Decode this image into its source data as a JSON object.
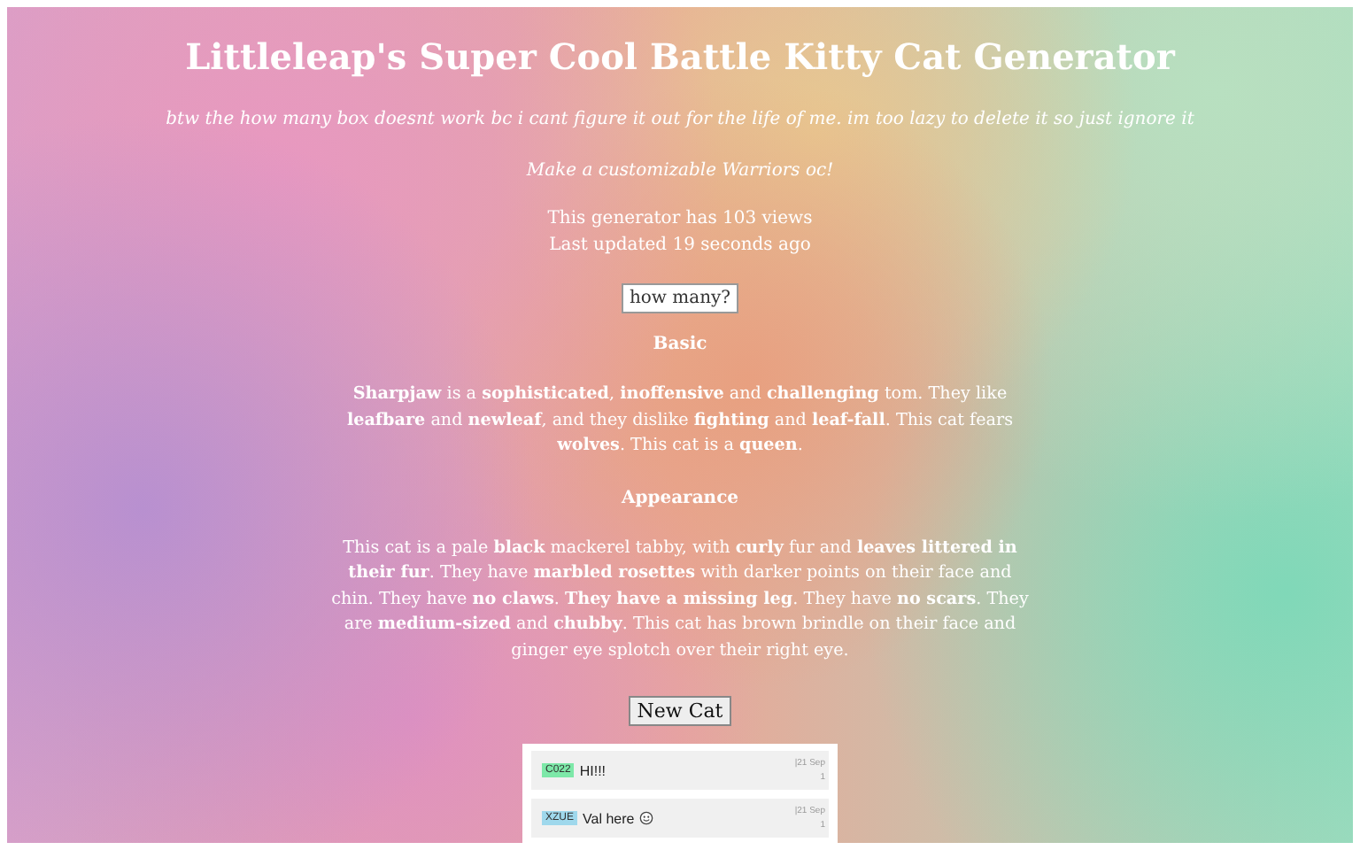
{
  "title": "Littleleap's Super Cool Battle Kitty Cat Generator",
  "note": "btw the how many box doesnt work bc i cant figure it out for the life of me. im too lazy to delete it so just ignore it",
  "tagline": "Make a customizable Warriors oc!",
  "views": "This generator has 103 views",
  "updated": "Last updated 19 seconds ago",
  "how_many_field": {
    "value": "how many?"
  },
  "sections": [
    {
      "heading": "Basic",
      "text": "**Sharpjaw** is a **sophisticated**, **inoffensive** and **challenging** tom. They like **leafbare** and **newleaf**, and they dislike **fighting** and **leaf-fall**. This cat fears **wolves**. This cat is a **queen**."
    },
    {
      "heading": "Appearance",
      "text": "This cat is a pale **black** mackerel tabby, with **curly** fur and **leaves littered in their fur**. They have **marbled rosettes** with darker points on their face and chin. They have **no claws**. **They have a missing leg**. They have **no scars**. They are **medium-sized** and **chubby**. This cat has brown brindle on their face and ginger eye splotch over their right eye."
    }
  ],
  "new_cat_button": "New Cat",
  "comments": [
    {
      "user": "C022",
      "color": "#7de8a8",
      "text": "HI!!!",
      "date": "|21 Sep",
      "date_line2": "1",
      "smiley": false
    },
    {
      "user": "XZUE",
      "color": "#9fd8ec",
      "text": "Val here",
      "date": "|21 Sep",
      "date_line2": "1",
      "smiley": true
    }
  ]
}
